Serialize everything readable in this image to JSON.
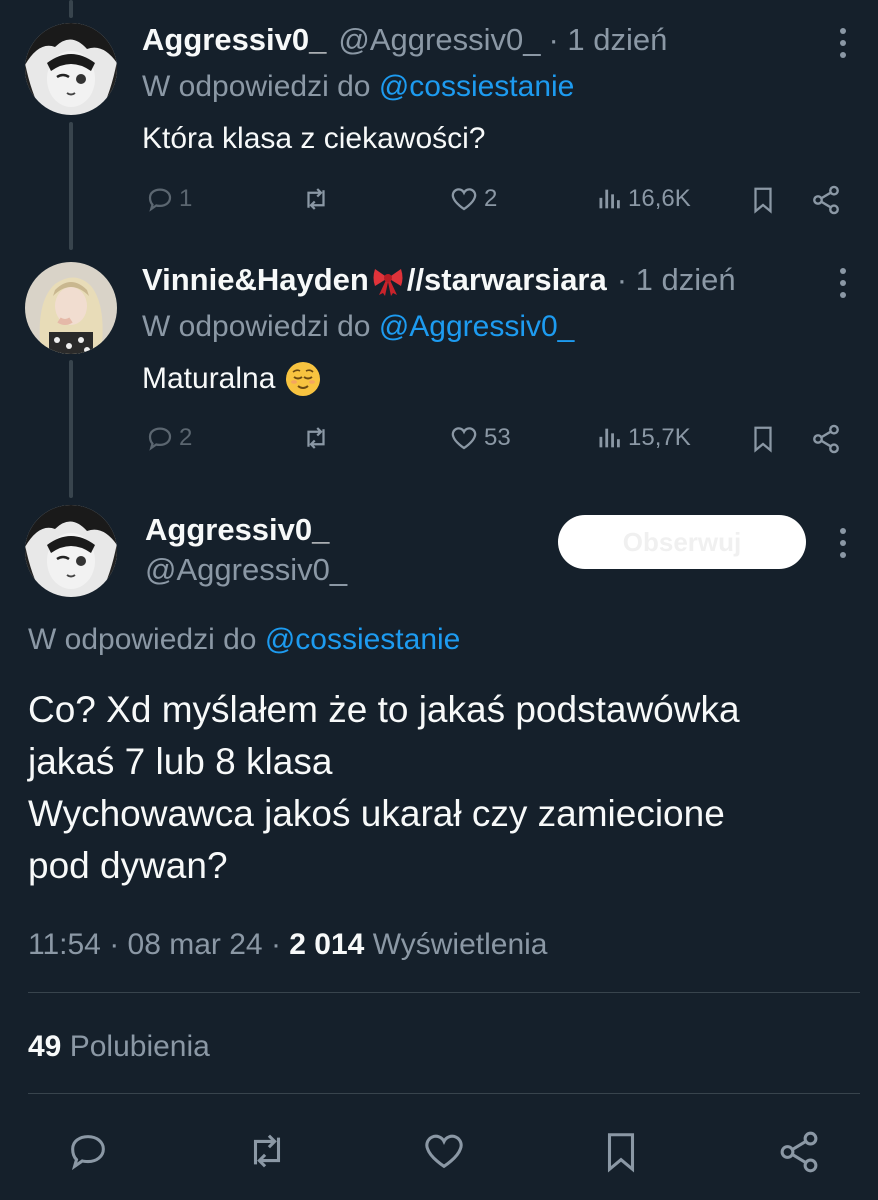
{
  "tweet1": {
    "name": "Aggressiv0_",
    "handle": "@Aggressiv0_",
    "time": "· 1 dzień",
    "reply_prefix": "W odpowiedzi do",
    "reply_to": "@cossiestanie",
    "text": "Która klasa z ciekawości?",
    "replies": "1",
    "likes": "2",
    "views": "16,6K"
  },
  "tweet2": {
    "name": "Vinnie&Hayden",
    "name_suffix": "//starwarsiara",
    "time": "· 1 dzień",
    "reply_prefix": "W odpowiedzi do",
    "reply_to": "@Aggressiv0_",
    "text": "Maturalna",
    "replies": "2",
    "likes": "53",
    "views": "15,7K"
  },
  "main": {
    "name": "Aggressiv0_",
    "handle": "@Aggressiv0_",
    "follow_label": "Obserwuj",
    "reply_prefix": "W odpowiedzi do",
    "reply_to": "@cossiestanie",
    "lines": [
      "Co? Xd myślałem że to jakaś podstawówka",
      "jakaś 7 lub 8 klasa",
      "Wychowawca jakoś ukarał czy zamiecione",
      "pod dywan?"
    ],
    "time": "11:54",
    "date": "08 mar 24",
    "views_count": "2 014",
    "views_label": "Wyświetlenia",
    "likes_count": "49",
    "likes_label": "Polubienia"
  },
  "colors": {
    "background": "#15202b",
    "text": "#f7f9f9",
    "muted": "#8b98a5",
    "link": "#1d9bf0",
    "divider": "#38444d"
  },
  "icons": [
    "reply-icon",
    "retweet-icon",
    "heart-icon",
    "views-icon",
    "bookmark-icon",
    "share-icon",
    "more-icon",
    "ribbon-emoji",
    "relieved-face-emoji"
  ]
}
